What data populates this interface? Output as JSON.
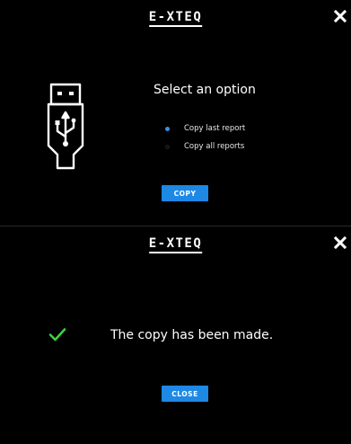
{
  "colors": {
    "background": "#000000",
    "accent": "#1e88e5",
    "success": "#3fd13f",
    "text": "#ffffff"
  },
  "top_dialog": {
    "logo_text": "E-XTEQ",
    "close_icon": "close-icon",
    "device_icon": "usb-icon",
    "title": "Select an option",
    "options": [
      {
        "label": "Copy last report",
        "selected": true
      },
      {
        "label": "Copy all reports",
        "selected": false
      }
    ],
    "button_label": "COPY"
  },
  "bottom_dialog": {
    "logo_text": "E-XTEQ",
    "close_icon": "close-icon",
    "status_icon": "checkmark-icon",
    "message": "The copy has been made.",
    "button_label": "CLOSE"
  }
}
